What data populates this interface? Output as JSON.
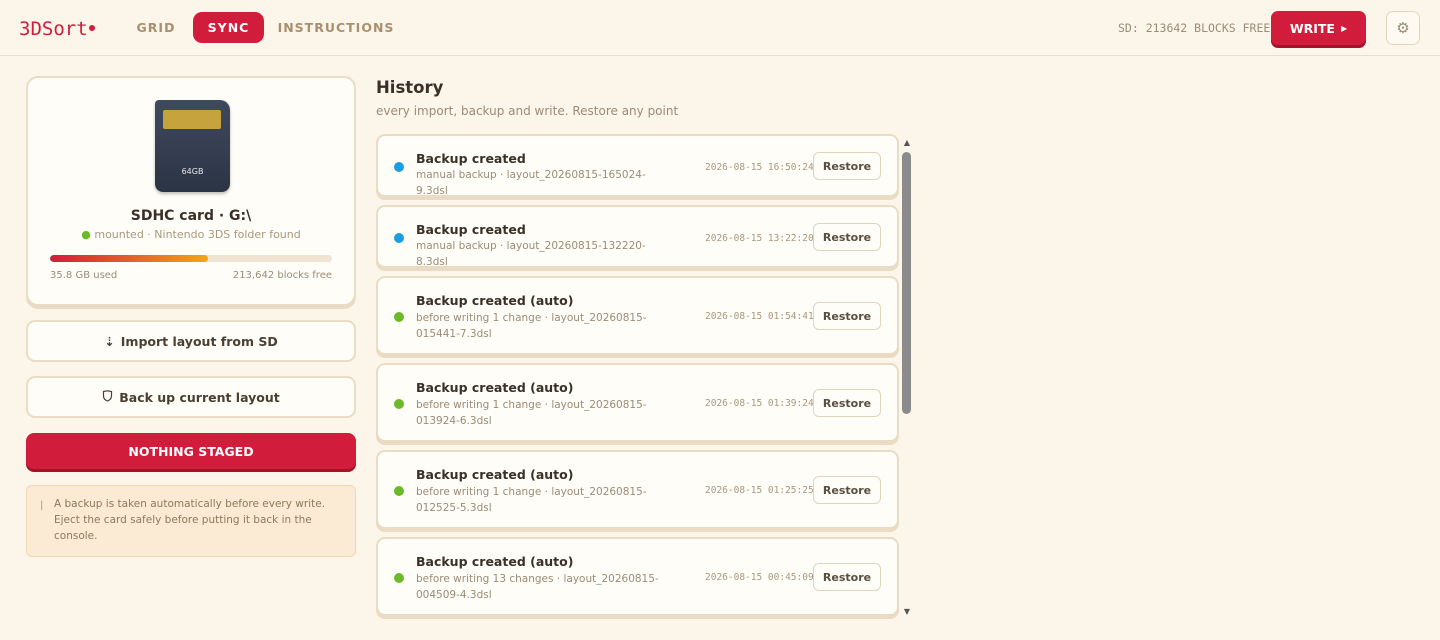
{
  "app": {
    "logo": "3DSort",
    "nav": [
      {
        "label": "GRID",
        "active": false
      },
      {
        "label": "SYNC",
        "active": true
      },
      {
        "label": "INSTRUCTIONS",
        "active": false
      }
    ],
    "sd_status": "SD: 213642 BLOCKS FREE",
    "write_label": "WRITE",
    "write_icon": "play-triangle-icon",
    "settings_icon": "gear-icon",
    "accent_color": "#d21c3c"
  },
  "card": {
    "size_label": "64GB",
    "title": "SDHC card · G:\\",
    "status": "mounted · Nintendo 3DS folder found",
    "status_color": "#6cba2a",
    "used": "35.8 GB used",
    "free": "213,642 blocks free",
    "usage_fraction": 0.56
  },
  "actions": {
    "import_label": "Import layout from SD",
    "import_icon": "download-arrow-icon",
    "backup_label": "Back up current layout",
    "backup_icon": "shield-icon",
    "stage_label": "NOTHING STAGED"
  },
  "note": {
    "text": "A backup is taken automatically before every write. Eject the card safely before putting it back in the console."
  },
  "history": {
    "title": "History",
    "subtitle": "every import, backup and write. Restore any point",
    "restore_label": "Restore",
    "items": [
      {
        "name": "Backup created",
        "detail": "manual backup · layout_20260815-165024-9.3dsl",
        "time": "2026-08-15 16:50:24",
        "kind": "manual",
        "color": "#1a9ee0"
      },
      {
        "name": "Backup created",
        "detail": "manual backup · layout_20260815-132220-8.3dsl",
        "time": "2026-08-15 13:22:20",
        "kind": "manual",
        "color": "#1a9ee0"
      },
      {
        "name": "Backup created (auto)",
        "detail": "before writing 1 change · layout_20260815-015441-7.3dsl",
        "time": "2026-08-15 01:54:41",
        "kind": "auto",
        "color": "#6cba2a"
      },
      {
        "name": "Backup created (auto)",
        "detail": "before writing 1 change · layout_20260815-013924-6.3dsl",
        "time": "2026-08-15 01:39:24",
        "kind": "auto",
        "color": "#6cba2a"
      },
      {
        "name": "Backup created (auto)",
        "detail": "before writing 1 change · layout_20260815-012525-5.3dsl",
        "time": "2026-08-15 01:25:25",
        "kind": "auto",
        "color": "#6cba2a"
      },
      {
        "name": "Backup created (auto)",
        "detail": "before writing 13 changes · layout_20260815-004509-4.3dsl",
        "time": "2026-08-15 00:45:09",
        "kind": "auto",
        "color": "#6cba2a"
      }
    ]
  }
}
